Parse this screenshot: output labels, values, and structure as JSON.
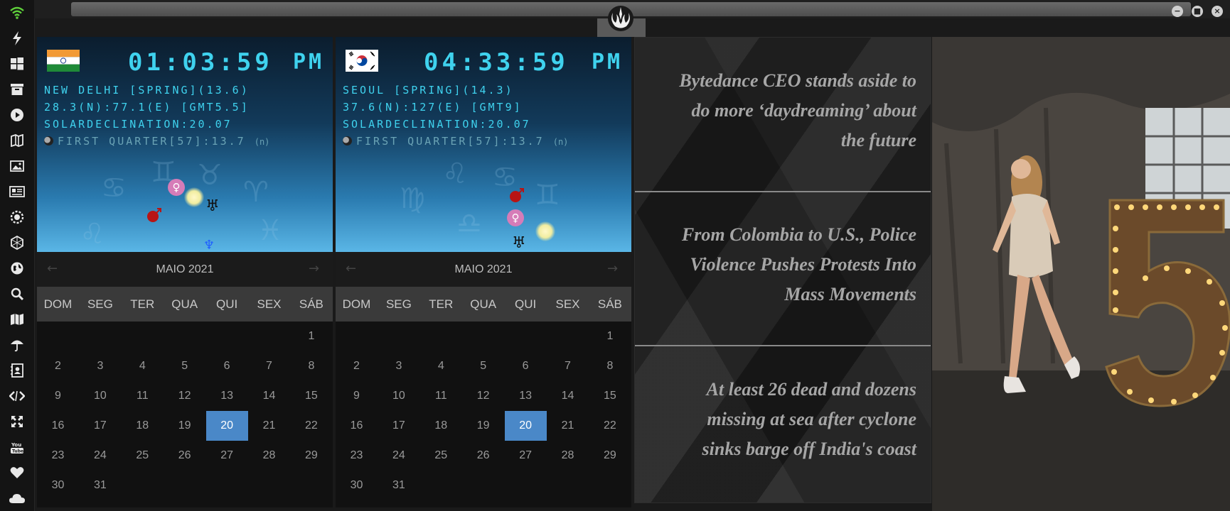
{
  "sidebar": {
    "icons": [
      "wifi-icon",
      "bolt-icon",
      "windows-icon",
      "archive-icon",
      "play-icon",
      "maps-book-icon",
      "image-icon",
      "news-icon",
      "settings-gear-icon",
      "hexagon-icon",
      "globe-icon",
      "search-icon",
      "map-icon",
      "umbrella-icon",
      "contacts-icon",
      "code-icon",
      "expand-icon",
      "youtube-icon",
      "heart-icon",
      "cloud-icon"
    ]
  },
  "window": {
    "logo": "rebel-alliance-icon",
    "controls": [
      "minimize",
      "maximize",
      "close"
    ]
  },
  "clocks": [
    {
      "flag": "india",
      "time": "01:03:59",
      "ampm": "PM",
      "line1": "NEW DELHI [SPRING](13.6)",
      "line2": "28.3(N):77.1(E) [GMT5.5]",
      "line3": "SOLARDECLINATION:20.07",
      "moon": "FIRST QUARTER[57]:13.7",
      "moon_suffix": "(n)"
    },
    {
      "flag": "south-korea",
      "time": "04:33:59",
      "ampm": "PM",
      "line1": "SEOUL [SPRING](14.3)",
      "line2": "37.6(N):127(E) [GMT9]",
      "line3": "SOLARDECLINATION:20.07",
      "moon": "FIRST QUARTER[57]:13.7",
      "moon_suffix": "(n)"
    }
  ],
  "planet_glyphs": {
    "venus": "♀",
    "mars": "♂",
    "uranus": "♅",
    "neptune": "♆"
  },
  "calendars": [
    {
      "month": "MAIO 2021",
      "prev": "←",
      "next": "→",
      "weekdays": [
        "DOM",
        "SEG",
        "TER",
        "QUA",
        "QUI",
        "SEX",
        "SÁB"
      ],
      "weeks": [
        [
          "",
          "",
          "",
          "",
          "",
          "",
          "1"
        ],
        [
          "2",
          "3",
          "4",
          "5",
          "6",
          "7",
          "8"
        ],
        [
          "9",
          "10",
          "11",
          "12",
          "13",
          "14",
          "15"
        ],
        [
          "16",
          "17",
          "18",
          "19",
          "20",
          "21",
          "22"
        ],
        [
          "23",
          "24",
          "25",
          "26",
          "27",
          "28",
          "29"
        ],
        [
          "30",
          "31",
          "",
          "",
          "",
          "",
          ""
        ]
      ],
      "selected": "20"
    },
    {
      "month": "MAIO 2021",
      "prev": "←",
      "next": "→",
      "weekdays": [
        "DOM",
        "SEG",
        "TER",
        "QUA",
        "QUI",
        "SEX",
        "SÁB"
      ],
      "weeks": [
        [
          "",
          "",
          "",
          "",
          "",
          "",
          "1"
        ],
        [
          "2",
          "3",
          "4",
          "5",
          "6",
          "7",
          "8"
        ],
        [
          "9",
          "10",
          "11",
          "12",
          "13",
          "14",
          "15"
        ],
        [
          "16",
          "17",
          "18",
          "19",
          "20",
          "21",
          "22"
        ],
        [
          "23",
          "24",
          "25",
          "26",
          "27",
          "28",
          "29"
        ],
        [
          "30",
          "31",
          "",
          "",
          "",
          "",
          ""
        ]
      ],
      "selected": "20"
    }
  ],
  "news": {
    "headlines": [
      [
        "Bytedance CEO stands aside to",
        "do more ‘daydreaming’ about",
        "the future"
      ],
      [
        "From Colombia to U.S., Police",
        "Violence Pushes Protests Into",
        "Mass Movements"
      ],
      [
        "At least 26 dead and dozens",
        "missing at sea after cyclone",
        "sinks barge off India's coast"
      ]
    ]
  },
  "photo": {
    "subject": "model-with-number-5-sign",
    "sign_text": "5"
  },
  "colors": {
    "clock_cyan": "#3fd2ee",
    "calendar_selected": "#4a88c8",
    "news_text": "#a6a6a6"
  }
}
